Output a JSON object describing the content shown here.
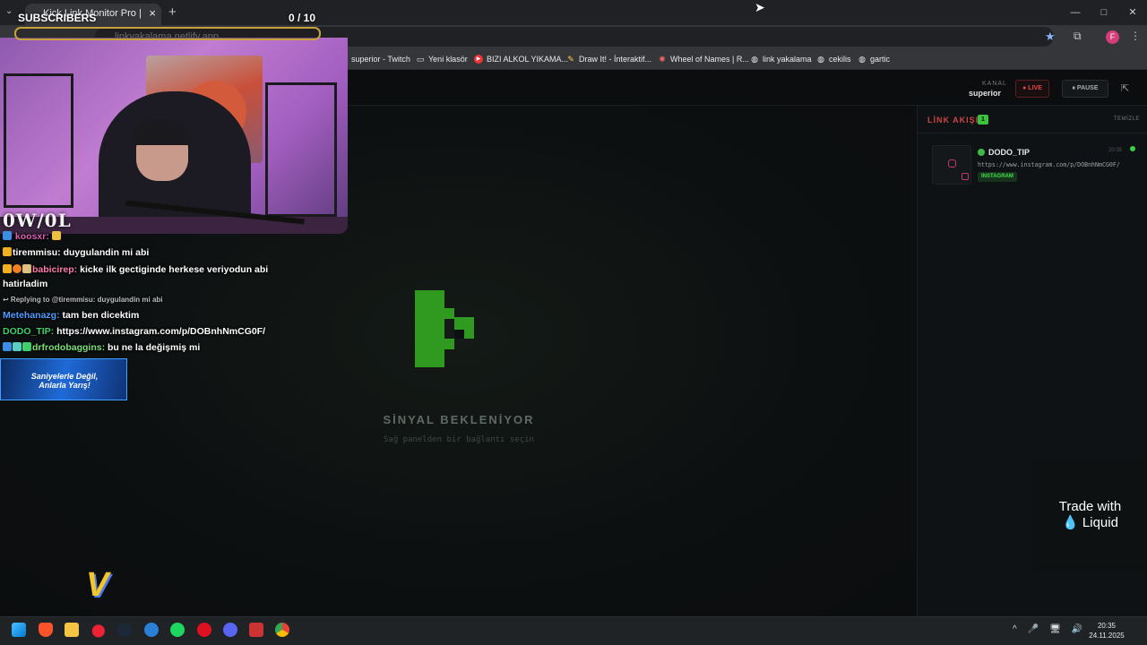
{
  "browser": {
    "tab_title": "Kick Link Monitor Pro | Stream Monitor",
    "tab_close": "×",
    "new_tab": "+",
    "url": "linkyakalama.netlify.app",
    "window_controls": [
      "—",
      "□",
      "✕"
    ],
    "bookmarks": [
      {
        "label": "superior - Twitch",
        "icon": "twitch-icon"
      },
      {
        "label": "Yeni klasör",
        "icon": "folder-icon"
      },
      {
        "label": "BIZI ALKOL YIKAMA...",
        "icon": "youtube-icon"
      },
      {
        "label": "Draw It! - İnteraktif...",
        "icon": "pencil-icon"
      },
      {
        "label": "Wheel of Names | R...",
        "icon": "wheel-icon"
      },
      {
        "label": "link yakalama",
        "icon": "globe-icon"
      },
      {
        "label": "cekilis",
        "icon": "globe-icon"
      },
      {
        "label": "gartic",
        "icon": "globe-icon"
      }
    ],
    "profile_initial": "F"
  },
  "app": {
    "kanal_label": "KANAL",
    "kanal_name": "superior",
    "live_label": "● LIVE",
    "pause_label": "⏸ PAUSE",
    "signal_title": "SİNYAL BEKLENİYOR",
    "signal_subtitle": "Sağ panelden bir bağlantı seçin",
    "feed_title": "LİNK AKIŞI",
    "feed_count": "1",
    "clear_label": "TEMİZLE",
    "links": [
      {
        "user": "DODO_TIP",
        "time": "20:35",
        "url": "https://www.instagram.com/p/DOBnhNmCG0F/",
        "platform": "INSTAGRAM"
      }
    ]
  },
  "overlay": {
    "subscribers_label": "SUBSCRIBERS",
    "goal_text": "0  / 10",
    "goal_progress": 0,
    "webcam_brand": "0W/0L",
    "chat": [
      {
        "user": "koosxr:",
        "message": "",
        "user_color": "#e05ab8"
      },
      {
        "user": "tiremmisu:",
        "message": " duygulandin mi abi",
        "user_color": "#ffffff"
      },
      {
        "user": "babicirep:",
        "message": " kicke ilk gectiginde herkese veriyodun abi",
        "user_color": "#ff7aa8"
      },
      {
        "user": "",
        "message": "hatirladim",
        "user_color": "#ffffff"
      },
      {
        "reply": "↩ Replying to @tiremmisu: duygulandin mi abi"
      },
      {
        "user": "Metehanazg:",
        "message": " tam ben dicektim",
        "user_color": "#4f9cff"
      },
      {
        "user": "DODO_TIP:",
        "message": " https://www.instagram.com/p/DOBnhNmCG0F/",
        "user_color": "#3fd06a"
      },
      {
        "user": "drfrodobaggins:",
        "message": " bu ne la değişmiş mi",
        "user_color": "#7be07b"
      }
    ],
    "promo_text_1": "Saniyelerle Değil,",
    "promo_text_2": "Anlarla Yarış!",
    "corner_logo": "V",
    "liquid_line1": "Trade with",
    "liquid_line2": "💧 Liquid"
  },
  "taskbar": {
    "time": "20:35",
    "date": "24.11.2025",
    "tray_icons": [
      "^",
      "🎤",
      "🖥",
      "🔊",
      "⌨"
    ]
  },
  "colors": {
    "accent_green": "#39c43c",
    "live_red": "#e54848",
    "logo_green": "#2f9a1f"
  }
}
